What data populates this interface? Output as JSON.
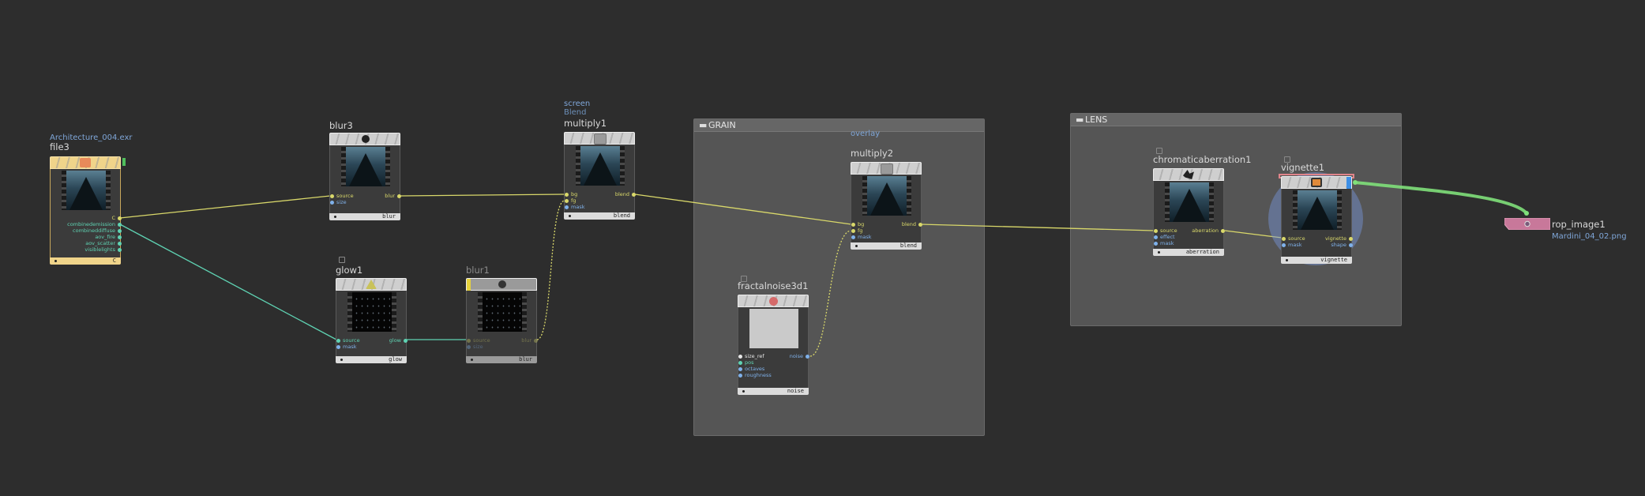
{
  "groups": {
    "grain": {
      "title": "GRAIN"
    },
    "lens": {
      "title": "LENS"
    }
  },
  "nodes": {
    "file3": {
      "name": "file3",
      "sub": "Architecture_004.exr",
      "icon": "file-icon",
      "outputs": [
        "C",
        "combinedemission",
        "combineddiffuse",
        "aov_fire",
        "aov_scatter",
        "visiblelights"
      ],
      "footer": "C"
    },
    "blur3": {
      "name": "blur3",
      "icon": "blur-icon",
      "inputs": [
        "source",
        "size"
      ],
      "outputs": [
        "blur"
      ],
      "footer": "blur"
    },
    "glow1": {
      "name": "glow1",
      "icon": "glow-icon",
      "inputs": [
        "source",
        "mask"
      ],
      "outputs": [
        "glow"
      ],
      "footer": "glow"
    },
    "blur1": {
      "name": "blur1",
      "icon": "blur-icon",
      "inputs": [
        "source",
        "size"
      ],
      "outputs": [
        "blur"
      ],
      "footer": "blur"
    },
    "multiply1": {
      "name": "multiply1",
      "sub": "screen",
      "sub2": "Blend",
      "icon": "blend-icon",
      "inputs": [
        "bg",
        "fg",
        "mask"
      ],
      "outputs": [
        "blend"
      ],
      "footer": "blend"
    },
    "multiply2": {
      "name": "multiply2",
      "sub": "overlay",
      "icon": "blend-icon",
      "inputs": [
        "bg",
        "fg",
        "mask"
      ],
      "outputs": [
        "blend"
      ],
      "footer": "blend"
    },
    "fractalnoise3d1": {
      "name": "fractalnoise3d1",
      "icon": "noise-icon",
      "inputs": [
        "size_ref",
        "pos",
        "octaves",
        "roughness"
      ],
      "outputs": [
        "noise"
      ],
      "footer": "noise"
    },
    "chromaticaberration1": {
      "name": "chromaticaberration1",
      "icon": "aberration-icon",
      "inputs": [
        "source",
        "effect",
        "mask"
      ],
      "outputs": [
        "aberration"
      ],
      "footer": "aberration"
    },
    "vignette1": {
      "name": "vignette1",
      "icon": "vignette-icon",
      "inputs": [
        "source",
        "mask"
      ],
      "outputs": [
        "vignette",
        "shape"
      ],
      "footer": "vignette"
    },
    "rop_image1": {
      "name": "rop_image1",
      "sub": "Mardini_04_02.png",
      "icon": "rop-icon"
    }
  },
  "colors": {
    "background": "#2d2d2d",
    "wire_yellow": "#d9d86a",
    "wire_green": "#5fd3b3",
    "wire_display": "#7fe07a",
    "file_node": "#f0d48a",
    "rop_node": "#c8789a",
    "selected_outline": "#e0848a",
    "display_flag": "#3d8fe6",
    "bypass_flag": "#e6d23c"
  }
}
